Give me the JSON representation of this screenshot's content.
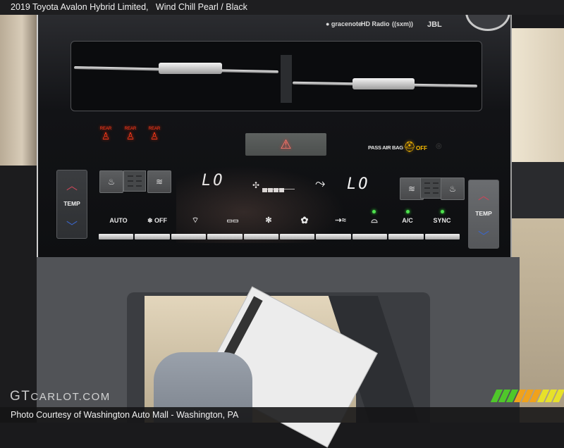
{
  "caption": {
    "title": "2019 Toyota Avalon Hybrid Limited,",
    "trim": "Wind Chill Pearl / Black"
  },
  "audio_logos": [
    {
      "name": "gracenote",
      "label": "● gracenote"
    },
    {
      "name": "hd-radio",
      "label": "HD Radio"
    },
    {
      "name": "sxm",
      "label": "((sxm))"
    },
    {
      "name": "jbl",
      "label": "JBL"
    }
  ],
  "seatbelt_indicators": [
    {
      "label": "REAR",
      "icon": "seatbelt-warning",
      "color": "#ff3b1d"
    },
    {
      "label": "REAR",
      "icon": "seatbelt-warning",
      "color": "#ff3b1d"
    },
    {
      "label": "REAR",
      "icon": "seatbelt-warning",
      "color": "#ff3b1d"
    }
  ],
  "hazard": {
    "icon": "hazard-triangle",
    "glyph": "⚠"
  },
  "airbag": {
    "label": "PASS AIR BAG",
    "status": "OFF",
    "color": "#ffc000"
  },
  "climate": {
    "left_temp": {
      "label": "TEMP",
      "up": "^",
      "down": "v",
      "display": "LO"
    },
    "right_temp": {
      "label": "TEMP",
      "up": "^",
      "down": "v",
      "display": "LO"
    },
    "fan_level_bars": 4,
    "buttons": [
      {
        "label": "AUTO",
        "led": false
      },
      {
        "label": "❄ OFF",
        "led": false
      },
      {
        "label": "⌔",
        "icon": "front-defrost",
        "led": false
      },
      {
        "label": "▭▭",
        "icon": "rear-defrost",
        "led": false
      },
      {
        "label": "✻",
        "icon": "fan-down",
        "led": false
      },
      {
        "label": "✿",
        "icon": "fan-up",
        "led": false
      },
      {
        "label": "⇢≈",
        "icon": "air-mode",
        "led": false
      },
      {
        "label": "⌓",
        "icon": "recirculation",
        "led": true
      },
      {
        "label": "A/C",
        "led": true
      },
      {
        "label": "SYNC",
        "led": true
      }
    ],
    "led_color": "#4fe24f"
  },
  "watermark": {
    "brand_a": "GT",
    "brand_b": "CARLOT.COM"
  },
  "credit": "Photo Courtesy of Washington Auto Mall - Washington, PA",
  "stripe_colors": [
    "#4fc72a",
    "#f0a21c",
    "#e7e12a"
  ]
}
